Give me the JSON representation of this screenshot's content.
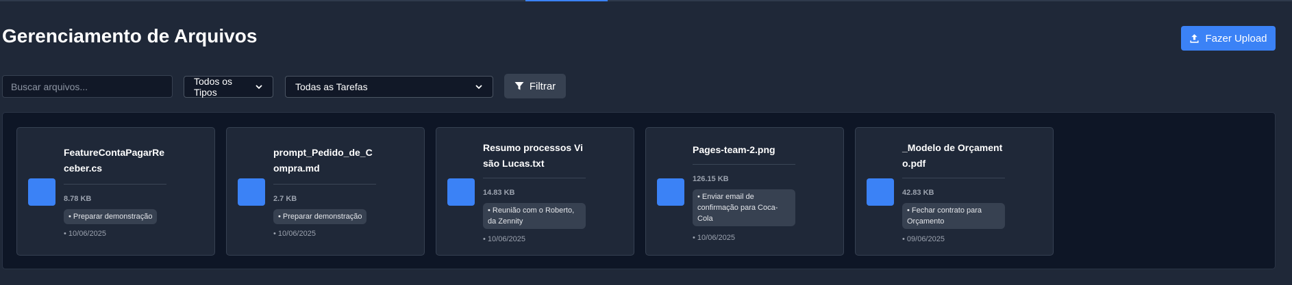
{
  "header": {
    "title": "Gerenciamento de Arquivos",
    "upload_label": "Fazer Upload"
  },
  "filters": {
    "search_placeholder": "Buscar arquivos...",
    "type_select": "Todos os Tipos",
    "task_select": "Todas as Tarefas",
    "filter_label": "Filtrar"
  },
  "files": [
    {
      "name": "FeatureContaPagarReceber.cs",
      "size": "8.78 KB",
      "task": "• Preparar demonstração",
      "date": "• 10/06/2025"
    },
    {
      "name": "prompt_Pedido_de_Compra.md",
      "size": "2.7 KB",
      "task": "• Preparar demonstração",
      "date": "• 10/06/2025"
    },
    {
      "name": "Resumo processos Visão Lucas.txt",
      "size": "14.83 KB",
      "task": "• Reunião com o Roberto, da Zennity",
      "date": "• 10/06/2025"
    },
    {
      "name": "Pages-team-2.png",
      "size": "126.15 KB",
      "task": "• Enviar email de confirmação para Coca-Cola",
      "date": "• 10/06/2025"
    },
    {
      "name": "_Modelo de Orçamento.pdf",
      "size": "42.83 KB",
      "task": "• Fechar contrato para Orçamento",
      "date": "• 09/06/2025"
    }
  ],
  "icons": {
    "upload": "upload-icon",
    "filter": "filter-icon",
    "dropdown": "chevron-down-icon",
    "file": "file-thumbnail"
  },
  "colors": {
    "accent": "#3b82f6",
    "background": "#1f2838",
    "panel": "#0e1626",
    "card": "#1f2838",
    "tag": "#374151"
  }
}
